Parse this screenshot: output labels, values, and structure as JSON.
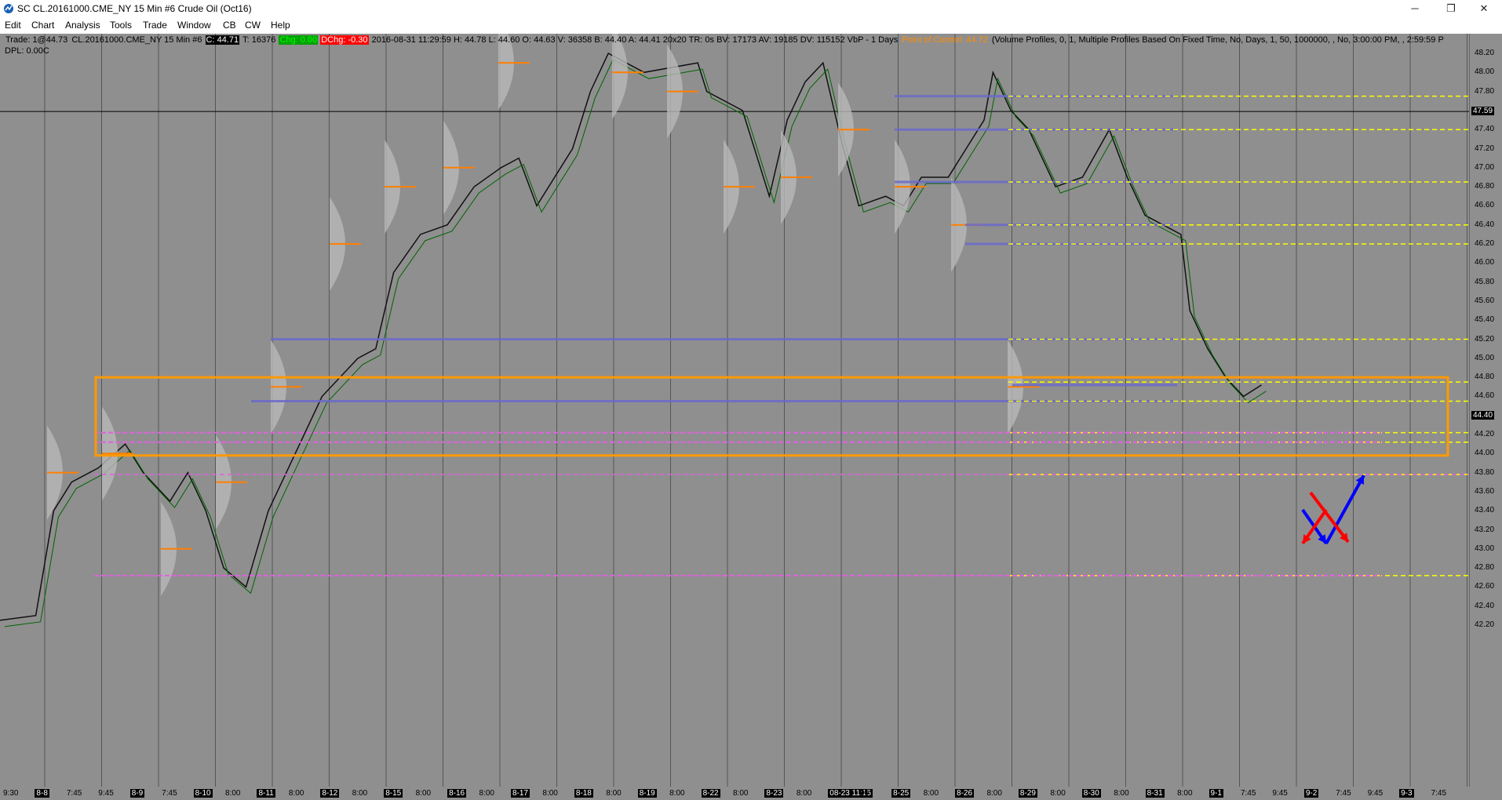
{
  "window": {
    "title": "SC CL.20161000.CME_NY  15 Min  #6  Crude Oil (Oct16)",
    "minimize": "─",
    "restore": "❐",
    "close": "✕"
  },
  "menu": [
    "Edit",
    "Chart",
    "Analysis",
    "Tools",
    "Trade",
    "Window",
    "CB",
    "CW",
    "Help"
  ],
  "header": {
    "trade": "Trade: 1@44.73",
    "symbol": "CL.20161000.CME_NY  15 Min  #6",
    "close": "C: 44.71",
    "t": "T: 16376",
    "chg": "Chg: 0.00",
    "dchg": "DChg: -0.30",
    "stats": "2016-08-31 11:29:59  H: 44.78  L: 44.60  O: 44.63  V: 36358  B: 44.40  A: 44.41  20x20  TR: 0s  BV: 17173  AV: 19185  DV: 115152  VbP - 1 Days",
    "poc": "Point of Control: 44.72",
    "study": "(Volume Profiles, 0, 1, Multiple Profiles Based On Fixed Time, No, Days, 1, 50, 1000000, , No, 3:00:00 PM, , 2:59:59 P",
    "dpl": "DPL: 0.00C"
  },
  "price_axis": {
    "ticks": [
      "48.20",
      "48.00",
      "47.80",
      "47.40",
      "47.20",
      "47.00",
      "46.80",
      "46.60",
      "46.40",
      "46.20",
      "46.00",
      "45.80",
      "45.60",
      "45.40",
      "45.20",
      "45.00",
      "44.80",
      "44.60",
      "44.20",
      "44.00",
      "43.80",
      "43.60",
      "43.40",
      "43.20",
      "43.00",
      "42.80",
      "42.60",
      "42.40",
      "42.20"
    ],
    "crosshair": "47.59",
    "bid": "44.40"
  },
  "time_axis": [
    {
      "label": "9:30",
      "day": false
    },
    {
      "label": "8-8",
      "day": true
    },
    {
      "label": "7:45",
      "day": false
    },
    {
      "label": "9:45",
      "day": false
    },
    {
      "label": "8-9",
      "day": true
    },
    {
      "label": "7:45",
      "day": false
    },
    {
      "label": "8-10",
      "day": true
    },
    {
      "label": "8:00",
      "day": false
    },
    {
      "label": "8-11",
      "day": true
    },
    {
      "label": "8:00",
      "day": false
    },
    {
      "label": "8-12",
      "day": true
    },
    {
      "label": "8:00",
      "day": false
    },
    {
      "label": "8-15",
      "day": true
    },
    {
      "label": "8:00",
      "day": false
    },
    {
      "label": "8-16",
      "day": true
    },
    {
      "label": "8:00",
      "day": false
    },
    {
      "label": "8-17",
      "day": true
    },
    {
      "label": "8:00",
      "day": false
    },
    {
      "label": "8-18",
      "day": true
    },
    {
      "label": "8:00",
      "day": false
    },
    {
      "label": "8-19",
      "day": true
    },
    {
      "label": "8:00",
      "day": false
    },
    {
      "label": "8-22",
      "day": true
    },
    {
      "label": "8:00",
      "day": false
    },
    {
      "label": "8-23",
      "day": true
    },
    {
      "label": "8:00",
      "day": false
    },
    {
      "label": "08-23  11:15",
      "day": true
    },
    {
      "label": "00",
      "day": false
    },
    {
      "label": "8-25",
      "day": true
    },
    {
      "label": "8:00",
      "day": false
    },
    {
      "label": "8-26",
      "day": true
    },
    {
      "label": "8:00",
      "day": false
    },
    {
      "label": "8-29",
      "day": true
    },
    {
      "label": "8:00",
      "day": false
    },
    {
      "label": "8-30",
      "day": true
    },
    {
      "label": "8:00",
      "day": false
    },
    {
      "label": "8-31",
      "day": true
    },
    {
      "label": "8:00",
      "day": false
    },
    {
      "label": "9-1",
      "day": true
    },
    {
      "label": "7:45",
      "day": false
    },
    {
      "label": "9:45",
      "day": false
    },
    {
      "label": "9-2",
      "day": true
    },
    {
      "label": "7:45",
      "day": false
    },
    {
      "label": "9:45",
      "day": false
    },
    {
      "label": "9-3",
      "day": true
    },
    {
      "label": "7:45",
      "day": false
    }
  ],
  "colors": {
    "background": "#8f8f8f",
    "zone_box": "#ff9900",
    "profile": "#b8b8b8",
    "poc_line": "#ff7f00",
    "vwap": "#006400",
    "level_yellow": "#ffff00",
    "level_blue": "#6a6acd",
    "level_pink": "#e060e0",
    "arrow_red": "#ff0000",
    "arrow_blue": "#0000ff"
  }
}
